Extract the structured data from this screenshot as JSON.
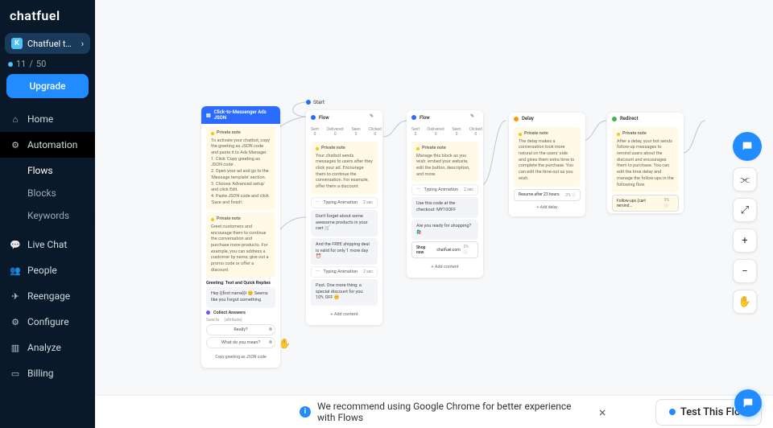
{
  "brand": "chatfuel",
  "project": {
    "initial": "K",
    "name": "Chatfuel tem..."
  },
  "quota": {
    "used": "11",
    "sep": " / ",
    "limit": "50"
  },
  "upgrade": "Upgrade",
  "nav": {
    "home": "Home",
    "automation": "Automation",
    "flows": "Flows",
    "blocks": "Blocks",
    "keywords": "Keywords",
    "livechat": "Live Chat",
    "people": "People",
    "reengage": "Reengage",
    "configure": "Configure",
    "analyze": "Analyze",
    "billing": "Billing"
  },
  "canvas": {
    "start": "Start",
    "node1": {
      "title": "Click-to-Messenger Ads JSON",
      "pn1": "Private note",
      "pn1_body": "To activate your chatbot, copy the greeting as JSON code and paste it to Ads Manager.\n1. Click 'Copy greeting as JSON code'.\n2. Open your ad and go to the 'Message template' section.\n3. Choose 'Advanced setup' and click Edit.\n4. Paste JSON code and click 'Save and finish'.",
      "pn2": "Private note",
      "pn2_body": "Greet customers and encourage them to continue the conversation and purchase more products. For example, you can address a customer by name, give out a promo code or offer a discount.",
      "greeting_hdr": "Greeting: Text and Quick Replies",
      "greeting_msg": "Hey {{first name}}! 😊 Seems like you forgot something",
      "collect": "Collect Answers",
      "save_to": "Save to",
      "save_attr": "(attribute)",
      "qr1": "Really?",
      "qr2": "What do you mean?",
      "copy": "Copy greeting as JSON code"
    },
    "node2": {
      "title": "Flow",
      "sent": "Sent",
      "delivered": "Delivered",
      "seen": "Seen",
      "clicked": "Clicked",
      "zero": "0",
      "pn": "Private note",
      "pn_body": "Your chatbot sends messages to users after they click your ad. Encourage them to continue the conversation. For example, offer them a discount.",
      "typing": "Typing Animation",
      "sec": "2 sec",
      "msg1": "Don't forget about some awesome products in your cart 🛒",
      "msg2": "And the FREE shipping deal is valid for only 1 more day ⏰",
      "msg3": "Psst. One more thing: a special discount for you: 10% OFF 🤫",
      "add": "+ Add content"
    },
    "node3": {
      "title": "Flow",
      "sent": "Sent",
      "delivered": "Delivered",
      "seen": "Seen",
      "clicked": "Clicked",
      "zero": "0",
      "pn": "Private note",
      "pn_body": "Manage this block as you wish: embed your website, edit the button, description, and more.",
      "typing": "Typing Animation",
      "sec": "2 sec",
      "msg1": "Use this code at the checkout: MY10OFF",
      "msg2": "Are you ready for shopping? 🛍️",
      "shop": "Shop now",
      "shop_url": "chatfuel.com",
      "pct": "0% ⓘ",
      "add": "+ Add content"
    },
    "node4": {
      "title": "Delay",
      "pn": "Private note",
      "pn_body": "The delay makes a conversation look more natural on the users' side and gives them extra time to complete the purchase. You can edit the time-out as you wish.",
      "resume": "Resume after 23 hours",
      "pct": "0% ⓘ",
      "add": "+ Add delay"
    },
    "node5": {
      "title": "Redirect",
      "pn": "Private note",
      "pn_body": "After a delay, your bot sends follow-up messages to remind users about the discount and encourages them to purchase. You can edit the time delay and manage the follow-ups in the following flow.",
      "flow": "Follow-ups (cart remind...",
      "pct": "0% ⓘ"
    }
  },
  "bottom": {
    "info": "We recommend using Google Chrome for better experience with Flows",
    "test": "Test This Flow"
  },
  "tools": {
    "plus": "+",
    "minus": "−",
    "hand": "✋",
    "fit": "⤢",
    "share": "⫘"
  }
}
